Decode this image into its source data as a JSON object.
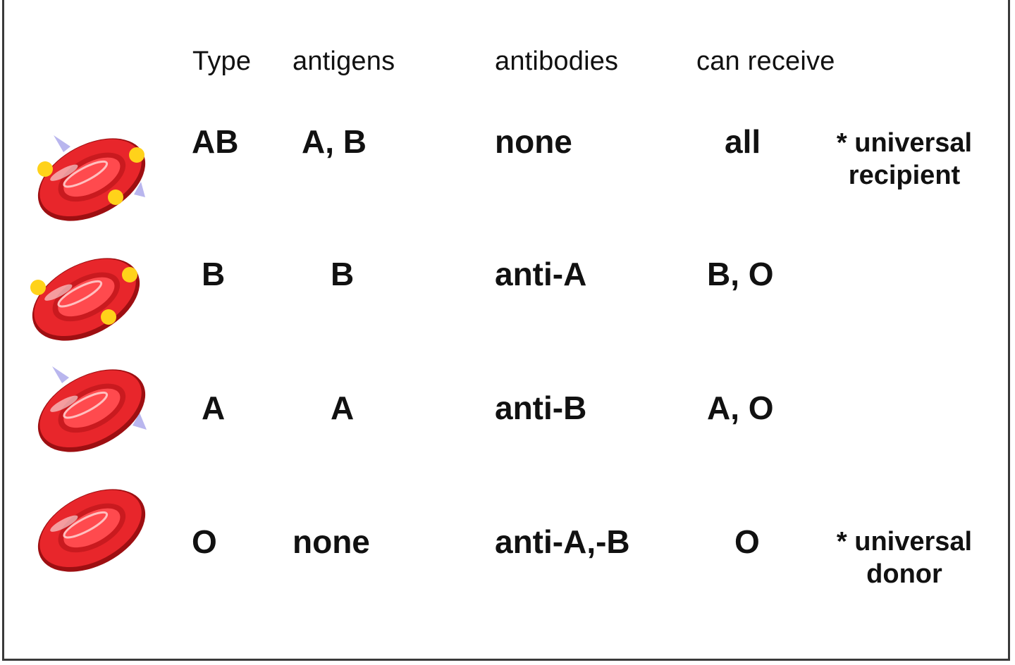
{
  "headers": {
    "type": "Type",
    "antigens": "antigens",
    "antibodies": "antibodies",
    "can_receive": "can receive"
  },
  "rows": [
    {
      "type": "AB",
      "antigens": "A, B",
      "antibodies": "none",
      "can_receive": "all",
      "note_line1": "* universal",
      "note_line2": "recipient",
      "cell_icon": "red-blood-cell-ab-icon",
      "antigen_dots": true,
      "lilac_spikes": true
    },
    {
      "type": "B",
      "antigens": "B",
      "antibodies": "anti-A",
      "can_receive": "B, O",
      "note_line1": "",
      "note_line2": "",
      "cell_icon": "red-blood-cell-b-icon",
      "antigen_dots": true,
      "lilac_spikes": false
    },
    {
      "type": "A",
      "antigens": "A",
      "antibodies": "anti-B",
      "can_receive": "A, O",
      "note_line1": "",
      "note_line2": "",
      "cell_icon": "red-blood-cell-a-icon",
      "antigen_dots": false,
      "lilac_spikes": true
    },
    {
      "type": "O",
      "antigens": "none",
      "antibodies": "anti-A,-B",
      "can_receive": "O",
      "note_line1": "* universal",
      "note_line2": "donor",
      "cell_icon": "red-blood-cell-o-icon",
      "antigen_dots": false,
      "lilac_spikes": false
    }
  ],
  "colors": {
    "cell_red": "#e8262b",
    "cell_dark": "#9e0f12",
    "cell_highlight": "#ff8a8a",
    "antigen_dot": "#ffd21a",
    "spike": "#b9b6ee"
  }
}
